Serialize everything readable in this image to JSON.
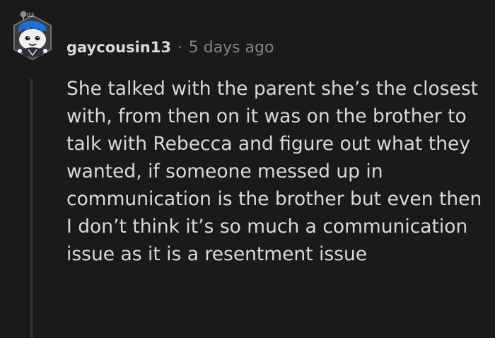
{
  "comment": {
    "avatar_icon": "snoo-avatar-icon",
    "username": "gaycousin13",
    "separator": "·",
    "timestamp": "5 days ago",
    "body": "She talked with the parent she’s the closest with, from then on it was on the brother to talk with Rebecca and figure out what they wanted, if someone messed up in communication is the brother but even then I don’t think it’s so much a communication issue as it is a resentment issue"
  },
  "colors": {
    "background": "#1a1a1b",
    "text": "#d7dadc",
    "muted": "#818384",
    "thread_line": "#343536",
    "avatar_accent": "#1e6fd9"
  }
}
